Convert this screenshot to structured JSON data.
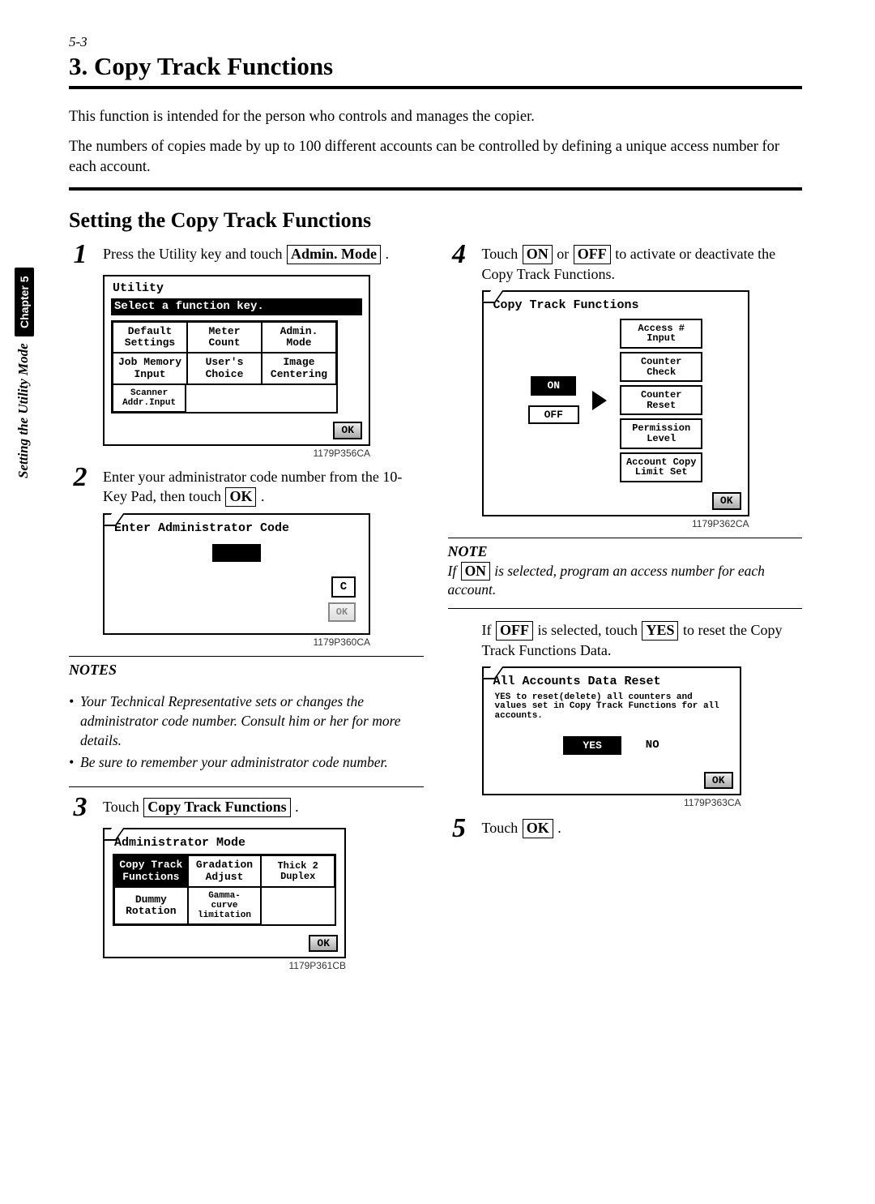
{
  "header": {
    "sec_ref": "5-3",
    "title": "3. Copy Track Functions"
  },
  "intro_l1": "This function is intended for the person who controls and manages the copier.",
  "intro_l2": "The numbers of copies made by up to 100 different accounts can be controlled by defining a unique access number for each account.",
  "subtitle": "Setting the Copy Track Functions",
  "step1_a": "Press the Utility key and touch",
  "step1_key": "Admin. Mode",
  "step1_dot": " .",
  "utility": {
    "title": "Utility",
    "sub": "Select a function key.",
    "b11": "Default\nSettings",
    "b12": "Meter\nCount",
    "b13": "Admin.\nMode",
    "b21": "Job Memory\nInput",
    "b22": "User's\nChoice",
    "b23": "Image\nCentering",
    "b31": "Scanner\nAddr.Input",
    "ok": "OK"
  },
  "cap1": "1179P356CA",
  "step2_a": "Enter your administrator code number from the 10-Key Pad, then touch ",
  "ok_label": "OK",
  "step2_dot": " .",
  "admin_code_title": "Enter Administrator Code",
  "c_label": "C",
  "cap2": "1179P360CA",
  "notes_title": "NOTES",
  "note1": "Your Technical Representative sets or changes the administrator code number. Consult him or her for more details.",
  "note2": "Be sure to remember your administrator code number.",
  "step3_a": "Touch ",
  "step3_key": "Copy Track Functions",
  "step3_dot": " .",
  "adminmode": {
    "title": "Administrator Mode",
    "b11": "Copy Track\nFunctions",
    "b12": "Gradation\nAdjust",
    "b13": "Thick 2\nDuplex",
    "b21": "Dummy\nRotation",
    "b22": "Gamma-\ncurve\nlimitation"
  },
  "cap3": "1179P361CB",
  "step4_a": "Touch ",
  "on": "ON",
  "off": "OFF",
  "step4_b": " or ",
  "step4_c": " to activate or deactivate the Copy Track Functions.",
  "ctf": {
    "title": "Copy Track Functions",
    "b1": "Access #\nInput",
    "b2": "Counter\nCheck",
    "b3": "Counter\nReset",
    "b4": "Permission\nLevel",
    "b5": "Account Copy\nLimit Set"
  },
  "cap4": "1179P362CA",
  "note_title_single": "NOTE",
  "note_on_a": "If ",
  "note_on_b": " is selected, program an access number for each account.",
  "off_a": "If ",
  "off_b": " is selected, touch ",
  "yes": "YES",
  "no": "NO",
  "off_c": " to reset the Copy Track Functions Data.",
  "reset": {
    "title": "All Accounts Data Reset",
    "msg": "YES to reset(delete) all counters and values set in Copy Track Functions for all accounts."
  },
  "cap5": "1179P363CA",
  "step5_a": "Touch ",
  "step5_dot": " .",
  "sidetab_a": "Setting the Utility Mode",
  "sidetab_ch": "Chapter 5"
}
